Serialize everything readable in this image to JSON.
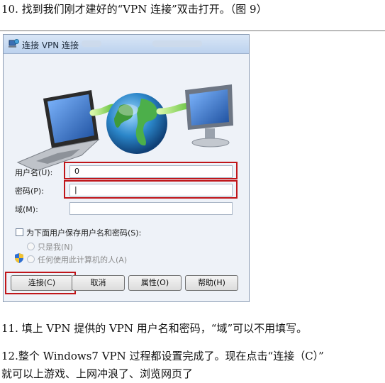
{
  "step10": "10. 找到我们刚才建好的“VPN 连接”双击打开。（图 9）",
  "dialog": {
    "title": "连接 VPN 连接",
    "username_label": "用户名(U):",
    "username_value": "0",
    "password_label": "密码(P):",
    "password_value": "|",
    "domain_label": "域(M):",
    "domain_value": "",
    "save_checkbox_label": "为下面用户保存用户名和密码(S):",
    "save_checked": false,
    "radio_me_only": "只是我(N)",
    "radio_anyone": "任何使用此计算机的人(A)",
    "buttons": {
      "connect": "连接(C)",
      "cancel": "取消",
      "properties": "属性(O)",
      "help": "帮助(H)"
    },
    "highlight_color": "#c0161a"
  },
  "step11": "11. 填上 VPN 提供的 VPN 用户名和密码，“域”可以不用填写。",
  "step12_line1": "12.整个 Windows7 VPN 过程都设置完成了。现在点击“连接（C）”",
  "step12_line2": "就可以上游戏、上网冲浪了、浏览网页了"
}
